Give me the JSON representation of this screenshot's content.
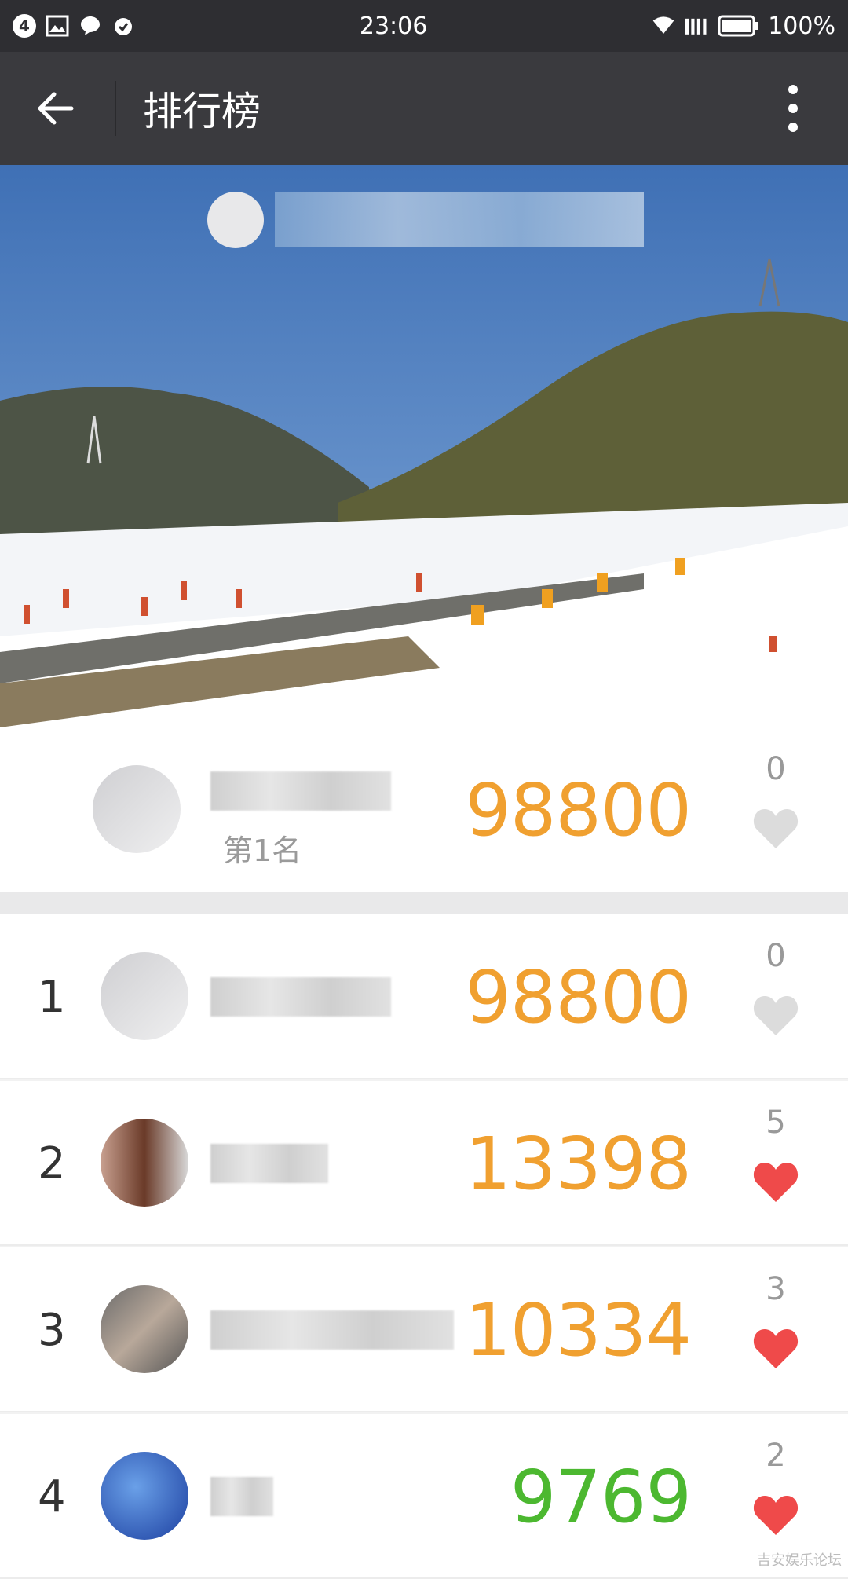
{
  "statusbar": {
    "notif_count": "4",
    "time": "23:06",
    "battery": "100%"
  },
  "header": {
    "title": "排行榜"
  },
  "my_entry": {
    "subtitle": "第1名",
    "score": "98800",
    "likes": "0",
    "liked": false
  },
  "ranking": [
    {
      "rank": "1",
      "score": "98800",
      "likes": "0",
      "liked": false,
      "score_color": "#f0a030"
    },
    {
      "rank": "2",
      "score": "13398",
      "likes": "5",
      "liked": true,
      "score_color": "#f0a030"
    },
    {
      "rank": "3",
      "score": "10334",
      "likes": "3",
      "liked": true,
      "score_color": "#f0a030"
    },
    {
      "rank": "4",
      "score": "9769",
      "likes": "2",
      "liked": true,
      "score_color": "#4cb830"
    }
  ],
  "watermark": "吉安娱乐论坛"
}
